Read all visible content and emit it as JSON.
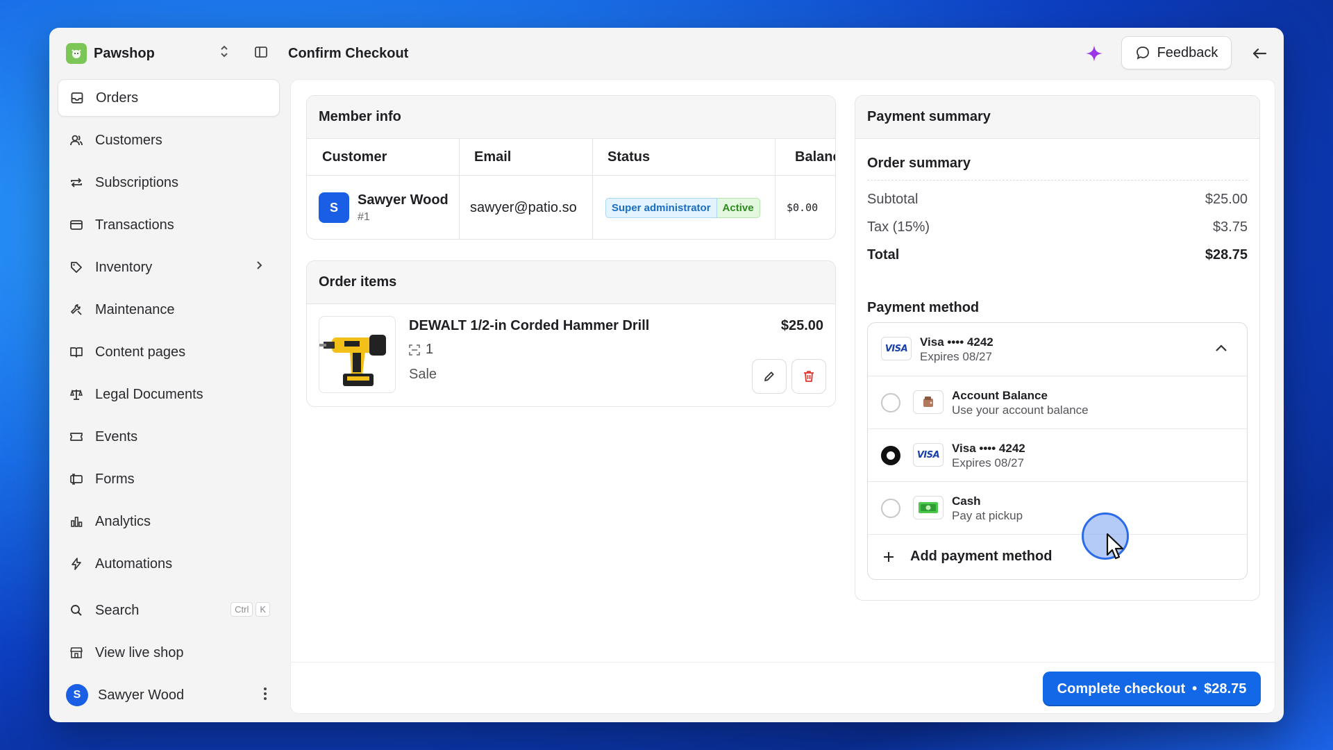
{
  "app": {
    "brand_name": "Pawshop",
    "page_title": "Confirm Checkout",
    "feedback_label": "Feedback"
  },
  "sidebar": {
    "items": [
      {
        "label": "Orders",
        "icon": "inbox-icon",
        "active": true
      },
      {
        "label": "Customers",
        "icon": "users-icon"
      },
      {
        "label": "Subscriptions",
        "icon": "repeat-icon"
      },
      {
        "label": "Transactions",
        "icon": "credit-card-icon"
      },
      {
        "label": "Inventory",
        "icon": "tag-icon"
      },
      {
        "label": "Maintenance",
        "icon": "wrench-icon"
      },
      {
        "label": "Content pages",
        "icon": "book-icon"
      },
      {
        "label": "Legal Documents",
        "icon": "scale-icon"
      },
      {
        "label": "Events",
        "icon": "ticket-icon"
      },
      {
        "label": "Forms",
        "icon": "form-icon"
      },
      {
        "label": "Analytics",
        "icon": "bar-chart-icon"
      },
      {
        "label": "Automations",
        "icon": "bolt-icon"
      }
    ],
    "search_label": "Search",
    "search_shortcut": [
      "Ctrl",
      "K"
    ],
    "live_shop_label": "View live shop",
    "user": {
      "initial": "S",
      "name": "Sawyer Wood"
    }
  },
  "member_info": {
    "title": "Member info",
    "columns": [
      "Customer",
      "Email",
      "Status",
      "Balanc"
    ],
    "row": {
      "initial": "S",
      "name": "Sawyer Wood",
      "id": "#1",
      "email": "sawyer@patio.so",
      "role_badge": "Super administrator",
      "status_badge": "Active",
      "balance": "$0.00"
    }
  },
  "order_items": {
    "title": "Order items",
    "item": {
      "name": "DEWALT 1/2-in Corded Hammer Drill",
      "quantity": "1",
      "type": "Sale",
      "price": "$25.00"
    }
  },
  "payment_summary": {
    "title": "Payment summary",
    "order_summary_title": "Order summary",
    "rows": [
      {
        "label": "Subtotal",
        "value": "$25.00"
      },
      {
        "label": "Tax (15%)",
        "value": "$3.75"
      },
      {
        "label": "Total",
        "value": "$28.75"
      }
    ],
    "payment_method_title": "Payment method",
    "selected": {
      "title": "Visa •••• 4242",
      "sub": "Expires 08/27"
    },
    "options": [
      {
        "title": "Account Balance",
        "sub": "Use your account balance",
        "checked": false,
        "icon": "wallet-icon"
      },
      {
        "title": "Visa •••• 4242",
        "sub": "Expires 08/27",
        "checked": true,
        "icon": "visa-icon"
      },
      {
        "title": "Cash",
        "sub": "Pay at pickup",
        "checked": false,
        "icon": "cash-icon"
      }
    ],
    "add_method_label": "Add payment method",
    "visa_mark": "VISA"
  },
  "checkout": {
    "label": "Complete checkout",
    "separator": "•",
    "amount": "$28.75"
  },
  "colors": {
    "accent": "#1368e8",
    "brand_logo": "#7cc657",
    "active_badge": "#2f8a1f",
    "admin_badge": "#1a6dbf",
    "delete": "#e0342b"
  }
}
